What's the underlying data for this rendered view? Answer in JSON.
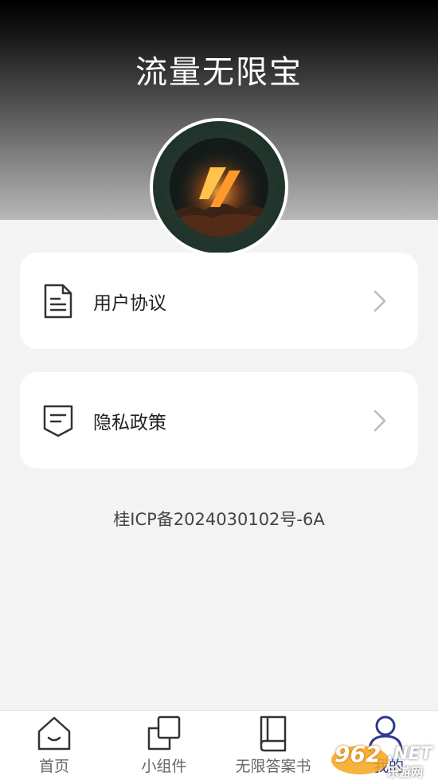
{
  "header": {
    "title": "流量无限宝"
  },
  "menu": [
    {
      "label": "用户协议",
      "icon": "document-icon"
    },
    {
      "label": "隐私政策",
      "icon": "message-icon"
    }
  ],
  "footer_text": "桂ICP备2024030102号-6A",
  "tabs": [
    {
      "label": "首页",
      "icon": "home-icon"
    },
    {
      "label": "小组件",
      "icon": "widgets-icon"
    },
    {
      "label": "无限答案书",
      "icon": "book-icon"
    },
    {
      "label": "我的",
      "icon": "user-icon",
      "active": true
    }
  ],
  "watermark": {
    "number": "962",
    "suffix": ".NET",
    "chinese": "乐游网"
  },
  "colors": {
    "accent": "#2e3a8c",
    "card_bg": "#ffffff",
    "page_bg": "#f3f3f3"
  }
}
